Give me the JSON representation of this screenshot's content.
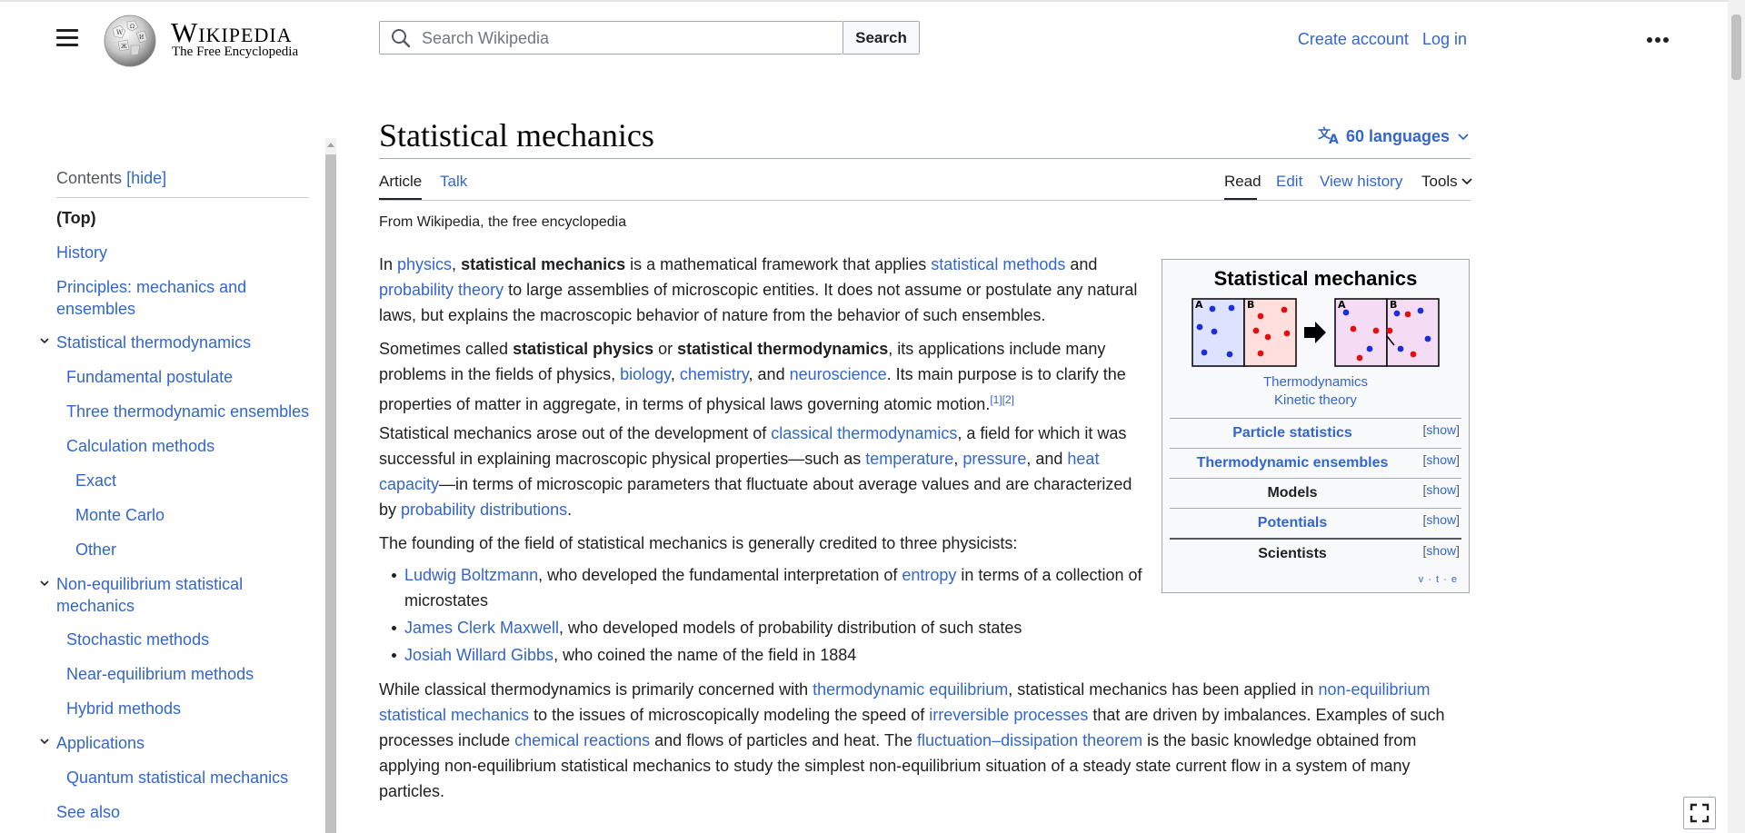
{
  "header": {
    "wordmark": "Wikipedia",
    "tagline": "The Free Encyclopedia",
    "search_placeholder": "Search Wikipedia",
    "search_button": "Search",
    "create_account": "Create account",
    "log_in": "Log in",
    "more_icon": "ellipsis-icon"
  },
  "toc": {
    "title": "Contents",
    "hide": "[hide]",
    "items": [
      {
        "label": "(Top)"
      },
      {
        "label": "History"
      },
      {
        "label": "Principles: mechanics and ensembles"
      },
      {
        "label": "Statistical thermodynamics"
      },
      {
        "label": "Fundamental postulate"
      },
      {
        "label": "Three thermodynamic ensembles"
      },
      {
        "label": "Calculation methods"
      },
      {
        "label": "Exact"
      },
      {
        "label": "Monte Carlo"
      },
      {
        "label": "Other"
      },
      {
        "label": "Non-equilibrium statistical mechanics"
      },
      {
        "label": "Stochastic methods"
      },
      {
        "label": "Near-equilibrium methods"
      },
      {
        "label": "Hybrid methods"
      },
      {
        "label": "Applications"
      },
      {
        "label": "Quantum statistical mechanics"
      },
      {
        "label": "See also"
      }
    ]
  },
  "article": {
    "title": "Statistical mechanics",
    "languages": "60 languages",
    "tabs": {
      "article": "Article",
      "talk": "Talk",
      "read": "Read",
      "edit": "Edit",
      "view_history": "View history",
      "tools": "Tools"
    },
    "from": "From Wikipedia, the free encyclopedia",
    "p1": {
      "a": "In ",
      "physics": "physics",
      "b": ", ",
      "bold": "statistical mechanics",
      "c": " is a mathematical framework that applies ",
      "statistical_methods": "statistical methods",
      "d": " and ",
      "probability_theory": "probability theory",
      "e": " to large assemblies of microscopic entities. It does not assume or postulate any natural laws, but explains the macroscopic behavior of nature from the behavior of such ensembles."
    },
    "p2": {
      "a": "Sometimes called ",
      "bold1": "statistical physics",
      "b": " or ",
      "bold2": "statistical thermodynamics",
      "c": ", its applications include many problems in the fields of physics, ",
      "biology": "biology",
      "d": ", ",
      "chemistry": "chemistry",
      "e": ", and ",
      "neuroscience": "neuroscience",
      "f": ". Its main purpose is to clarify the properties of matter in aggregate, in terms of physical laws governing atomic motion.",
      "refs": "[1][2]"
    },
    "p3": {
      "a": "Statistical mechanics arose out of the development of ",
      "classical_thermodynamics": "classical thermodynamics",
      "b": ", a field for which it was successful in explaining macroscopic physical properties—such as ",
      "temperature": "temperature",
      "c": ", ",
      "pressure": "pressure",
      "d": ", and ",
      "heat_capacity": "heat capacity",
      "e": "—in terms of microscopic parameters that fluctuate about average values and are characterized by ",
      "probability_distributions": "probability distributions",
      "f": "."
    },
    "p4": "The founding of the field of statistical mechanics is generally credited to three physicists:",
    "physicists": [
      {
        "name": "Ludwig Boltzmann",
        "text_a": ", who developed the fundamental interpretation of ",
        "link2": "entropy",
        "text_b": " in terms of a collection of microstates"
      },
      {
        "name": "James Clerk Maxwell",
        "text_a": ", who developed models of probability distribution of such states",
        "link2": "",
        "text_b": ""
      },
      {
        "name": "Josiah Willard Gibbs",
        "text_a": ", who coined the name of the field in 1884",
        "link2": "",
        "text_b": ""
      }
    ],
    "p5": {
      "a": "While classical thermodynamics is primarily concerned with ",
      "thermodynamic_equilibrium": "thermodynamic equilibrium",
      "b": ", statistical mechanics has been applied in ",
      "non_equilibrium": "non-equilibrium statistical mechanics",
      "c": " to the issues of microscopically modeling the speed of ",
      "irreversible": "irreversible processes",
      "d": " that are driven by imbalances. Examples of such processes include ",
      "chemical_reactions": "chemical reactions",
      "e": " and flows of particles and heat. The ",
      "fdt": "fluctuation–dissipation theorem",
      "f": " is the basic knowledge obtained from applying non-equilibrium statistical mechanics to study the simplest non-equilibrium situation of a steady state current flow in a system of many particles."
    }
  },
  "infobox": {
    "title": "Statistical mechanics",
    "img_labels": {
      "a": "A",
      "b": "B"
    },
    "link1": "Thermodynamics",
    "link2": "Kinetic theory",
    "rows": [
      {
        "label": "Particle statistics",
        "show": "show"
      },
      {
        "label": "Thermodynamic ensembles",
        "show": "show"
      },
      {
        "label": "Models",
        "show": "show"
      },
      {
        "label": "Potentials",
        "show": "show"
      },
      {
        "label": "Scientists",
        "show": "show"
      }
    ],
    "vte": "v · t · e"
  },
  "colors": {
    "link": "#3366cc",
    "text": "#202122",
    "border": "#a2a9b1"
  }
}
